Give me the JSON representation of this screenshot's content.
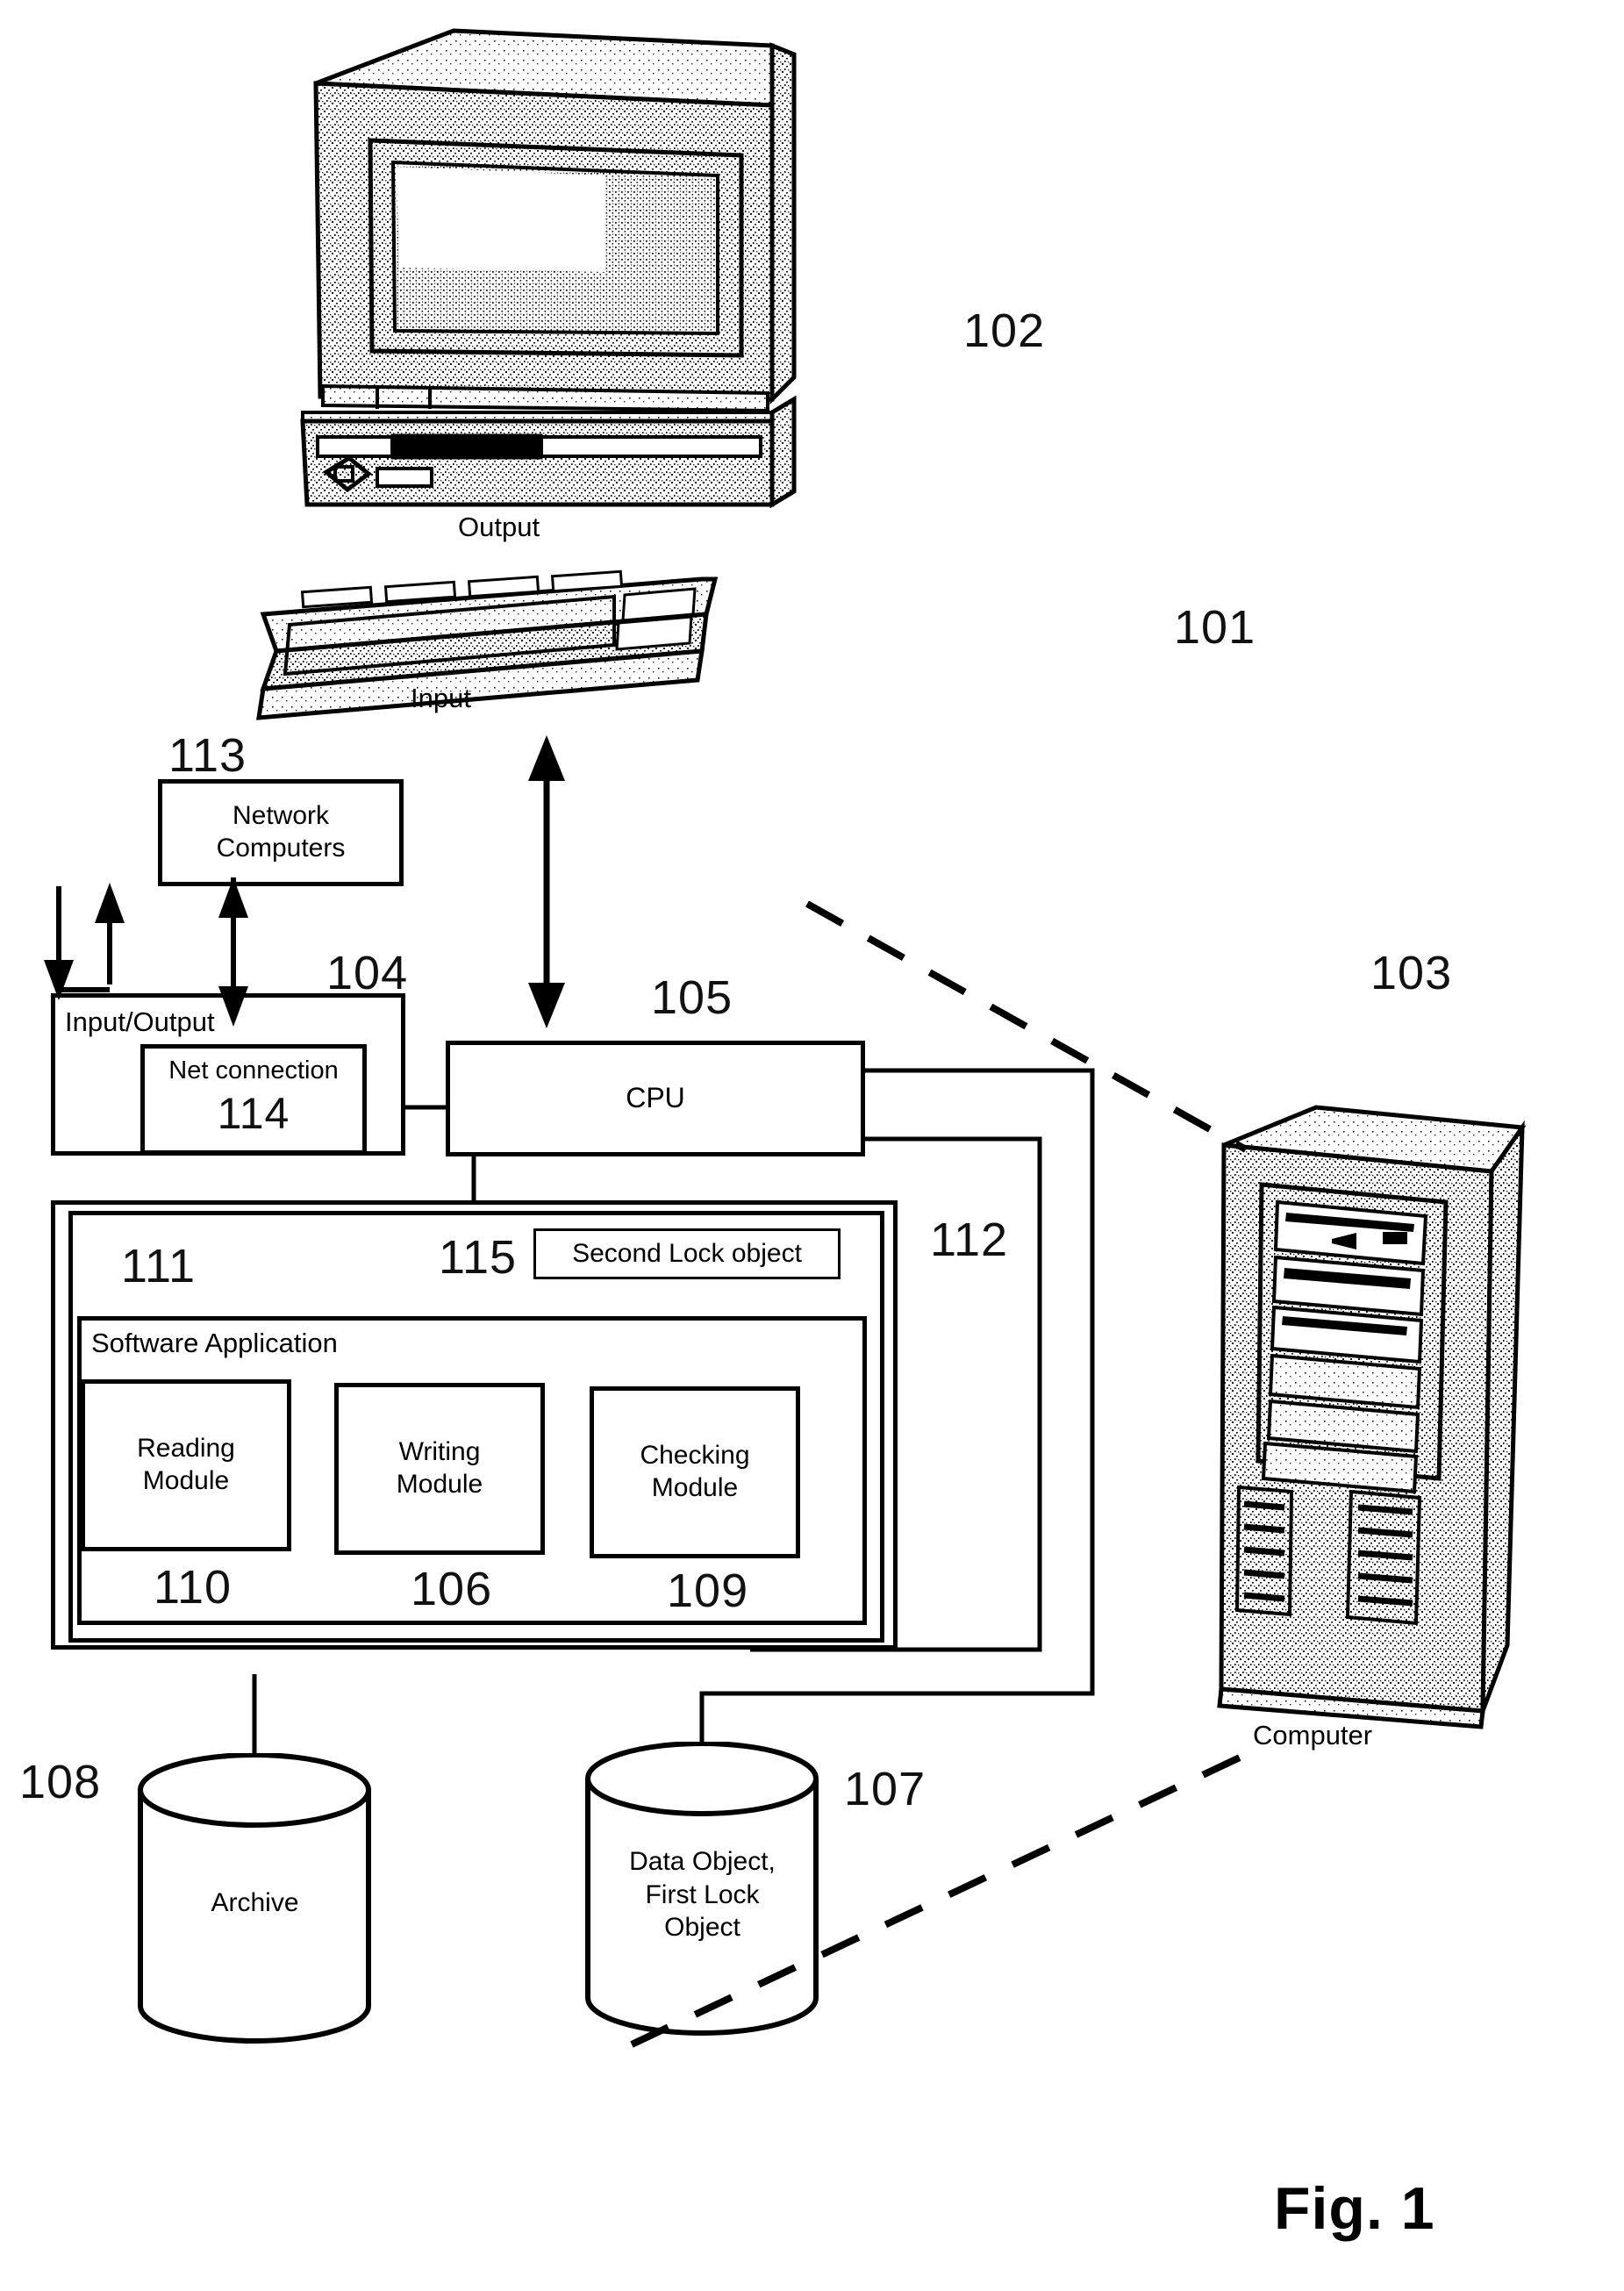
{
  "figure": {
    "title": "Fig. 1",
    "domain": "patent-block-diagram"
  },
  "devices": {
    "monitor": {
      "caption": "Output",
      "ref": "102"
    },
    "keyboard": {
      "caption": "Input",
      "ref": "101"
    },
    "server_tower": {
      "caption": "Computer",
      "ref": "103"
    }
  },
  "blocks": {
    "network_computers": {
      "label": "Network\nComputers",
      "ref": "113"
    },
    "input_output": {
      "label": "Input/Output",
      "ref": "104"
    },
    "net_connection": {
      "label": "Net connection",
      "ref": "114"
    },
    "cpu": {
      "label": "CPU",
      "ref": "105"
    },
    "memory_outer": {
      "ref": "112"
    },
    "memory_inner": {
      "ref": "111"
    },
    "second_lock_object": {
      "label": "Second Lock object",
      "ref": "115"
    },
    "software_application": {
      "label": "Software Application"
    },
    "reading_module": {
      "label": "Reading\nModule",
      "ref": "110"
    },
    "writing_module": {
      "label": "Writing\nModule",
      "ref": "106"
    },
    "checking_module": {
      "label": "Checking\nModule",
      "ref": "109"
    }
  },
  "stores": {
    "archive": {
      "label": "Archive",
      "ref": "108"
    },
    "data_object": {
      "label": "Data Object,\nFirst Lock\nObject",
      "ref": "107"
    }
  },
  "colors": {
    "ink": "#000000",
    "paper": "#ffffff"
  }
}
